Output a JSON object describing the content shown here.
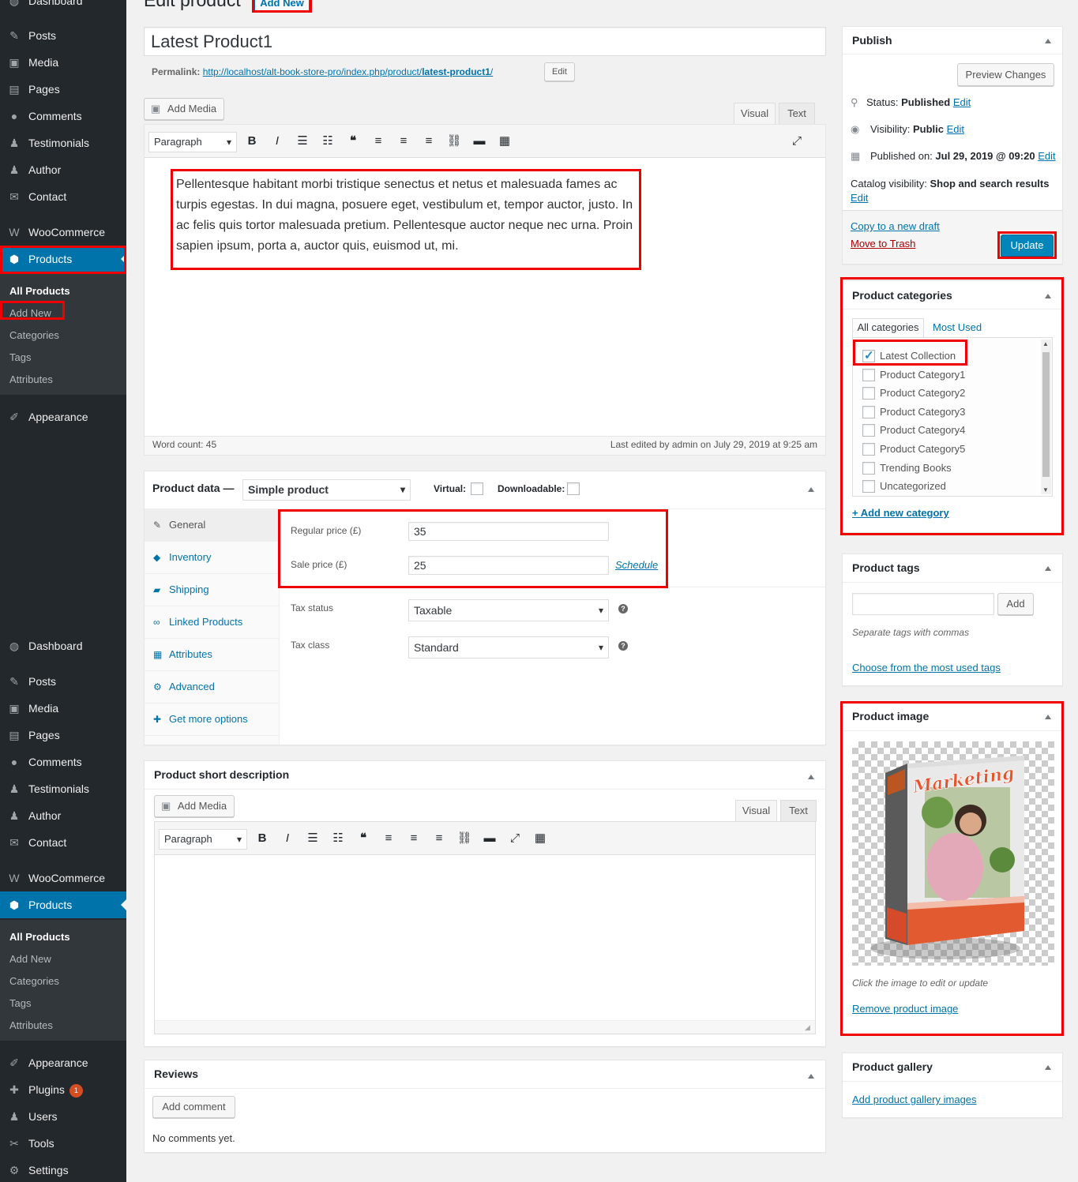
{
  "sidebar_top": {
    "items": [
      {
        "label": "Dashboard",
        "icon": "dashboard-icon",
        "glyph": "◍"
      },
      {
        "label": "Posts",
        "icon": "pin-icon",
        "glyph": "✎"
      },
      {
        "label": "Media",
        "icon": "media-icon",
        "glyph": "▣"
      },
      {
        "label": "Pages",
        "icon": "pages-icon",
        "glyph": "▤"
      },
      {
        "label": "Comments",
        "icon": "comments-icon",
        "glyph": "●"
      },
      {
        "label": "Testimonials",
        "icon": "user-icon",
        "glyph": "♟"
      },
      {
        "label": "Author",
        "icon": "user-icon",
        "glyph": "♟"
      },
      {
        "label": "Contact",
        "icon": "email-icon",
        "glyph": "✉"
      },
      {
        "label": "WooCommerce",
        "icon": "woocommerce-icon",
        "glyph": "W"
      },
      {
        "label": "Products",
        "icon": "products-icon",
        "glyph": "⬢"
      },
      {
        "label": "Appearance",
        "icon": "appearance-icon",
        "glyph": "✐"
      }
    ],
    "sub": [
      "All Products",
      "Add New",
      "Categories",
      "Tags",
      "Attributes"
    ]
  },
  "sidebar_bottom": {
    "items": [
      {
        "label": "Dashboard",
        "icon": "dashboard-icon",
        "glyph": "◍"
      },
      {
        "label": "Posts",
        "icon": "pin-icon",
        "glyph": "✎"
      },
      {
        "label": "Media",
        "icon": "media-icon",
        "glyph": "▣"
      },
      {
        "label": "Pages",
        "icon": "pages-icon",
        "glyph": "▤"
      },
      {
        "label": "Comments",
        "icon": "comments-icon",
        "glyph": "●"
      },
      {
        "label": "Testimonials",
        "icon": "user-icon",
        "glyph": "♟"
      },
      {
        "label": "Author",
        "icon": "user-icon",
        "glyph": "♟"
      },
      {
        "label": "Contact",
        "icon": "email-icon",
        "glyph": "✉"
      },
      {
        "label": "WooCommerce",
        "icon": "woocommerce-icon",
        "glyph": "W"
      },
      {
        "label": "Products",
        "icon": "products-icon",
        "glyph": "⬢"
      },
      {
        "label": "Appearance",
        "icon": "appearance-icon",
        "glyph": "✐"
      },
      {
        "label": "Plugins",
        "icon": "plugins-icon",
        "glyph": "✚",
        "badge": "1"
      },
      {
        "label": "Users",
        "icon": "users-icon",
        "glyph": "♟"
      },
      {
        "label": "Tools",
        "icon": "tools-icon",
        "glyph": "✂"
      },
      {
        "label": "Settings",
        "icon": "settings-icon",
        "glyph": "⚙"
      }
    ],
    "sub": [
      "All Products",
      "Add New",
      "Categories",
      "Tags",
      "Attributes"
    ]
  },
  "header": {
    "title": "Edit product",
    "add_new": "Add New"
  },
  "post": {
    "title": "Latest Product1",
    "permalink_label": "Permalink:",
    "permalink_base": "http://localhost/alt-book-store-pro/index.php/product/",
    "permalink_slug": "latest-product1",
    "permalink_end": "/",
    "edit_btn": "Edit"
  },
  "editor": {
    "add_media": "Add Media",
    "tab_visual": "Visual",
    "tab_text": "Text",
    "format": "Paragraph",
    "content": "Pellentesque habitant morbi tristique senectus et netus et malesuada fames ac turpis egestas. In dui magna, posuere eget, vestibulum et, tempor auctor, justo. In ac felis quis tortor malesuada pretium. Pellentesque auctor neque nec urna. Proin sapien ipsum, porta a, auctor quis, euismod ut, mi.",
    "word_count": "Word count: 45",
    "last_edited": "Last edited by admin on July 29, 2019 at 9:25 am"
  },
  "product_data": {
    "title": "Product data —",
    "type": "Simple product",
    "virtual": "Virtual:",
    "downloadable": "Downloadable:",
    "tabs": [
      {
        "label": "General",
        "icon": "wrench-icon",
        "glyph": "✎"
      },
      {
        "label": "Inventory",
        "icon": "tag-icon",
        "glyph": "◆"
      },
      {
        "label": "Shipping",
        "icon": "truck-icon",
        "glyph": "▰"
      },
      {
        "label": "Linked Products",
        "icon": "link-icon",
        "glyph": "∞"
      },
      {
        "label": "Attributes",
        "icon": "list-icon",
        "glyph": "▦"
      },
      {
        "label": "Advanced",
        "icon": "gear-icon",
        "glyph": "⚙"
      },
      {
        "label": "Get more options",
        "icon": "plugin-icon",
        "glyph": "✚"
      }
    ],
    "regular_price_label": "Regular price (£)",
    "regular_price": "35",
    "sale_price_label": "Sale price (£)",
    "sale_price": "25",
    "schedule": "Schedule",
    "tax_status_label": "Tax status",
    "tax_status": "Taxable",
    "tax_class_label": "Tax class",
    "tax_class": "Standard"
  },
  "short_desc": {
    "title": "Product short description",
    "add_media": "Add Media",
    "tab_visual": "Visual",
    "tab_text": "Text",
    "format": "Paragraph"
  },
  "reviews": {
    "title": "Reviews",
    "add_comment": "Add comment",
    "none": "No comments yet."
  },
  "publish": {
    "title": "Publish",
    "preview": "Preview Changes",
    "status_label": "Status:",
    "status": "Published",
    "visibility_label": "Visibility:",
    "visibility": "Public",
    "published_label": "Published on:",
    "published": "Jul 29, 2019 @ 09:20",
    "catalog_label": "Catalog visibility:",
    "catalog": "Shop and search results",
    "edit": "Edit",
    "copy": "Copy to a new draft",
    "trash": "Move to Trash",
    "update": "Update"
  },
  "categories": {
    "title": "Product categories",
    "tab_all": "All categories",
    "tab_used": "Most Used",
    "items": [
      {
        "label": "Latest Collection",
        "checked": true
      },
      {
        "label": "Product Category1",
        "checked": false
      },
      {
        "label": "Product Category2",
        "checked": false
      },
      {
        "label": "Product Category3",
        "checked": false
      },
      {
        "label": "Product Category4",
        "checked": false
      },
      {
        "label": "Product Category5",
        "checked": false
      },
      {
        "label": "Trending Books",
        "checked": false
      },
      {
        "label": "Uncategorized",
        "checked": false
      }
    ],
    "add_new": "+ Add new category"
  },
  "tags": {
    "title": "Product tags",
    "add": "Add",
    "hint": "Separate tags with commas",
    "choose": "Choose from the most used tags"
  },
  "image": {
    "title": "Product image",
    "book_title": "Marketing",
    "hint": "Click the image to edit or update",
    "remove": "Remove product image"
  },
  "gallery": {
    "title": "Product gallery",
    "add": "Add product gallery images"
  },
  "colors": {
    "accent": "#0073aa",
    "highlight": "#e00000",
    "sidebar": "#23282d",
    "primary_btn": "#0085ba"
  }
}
